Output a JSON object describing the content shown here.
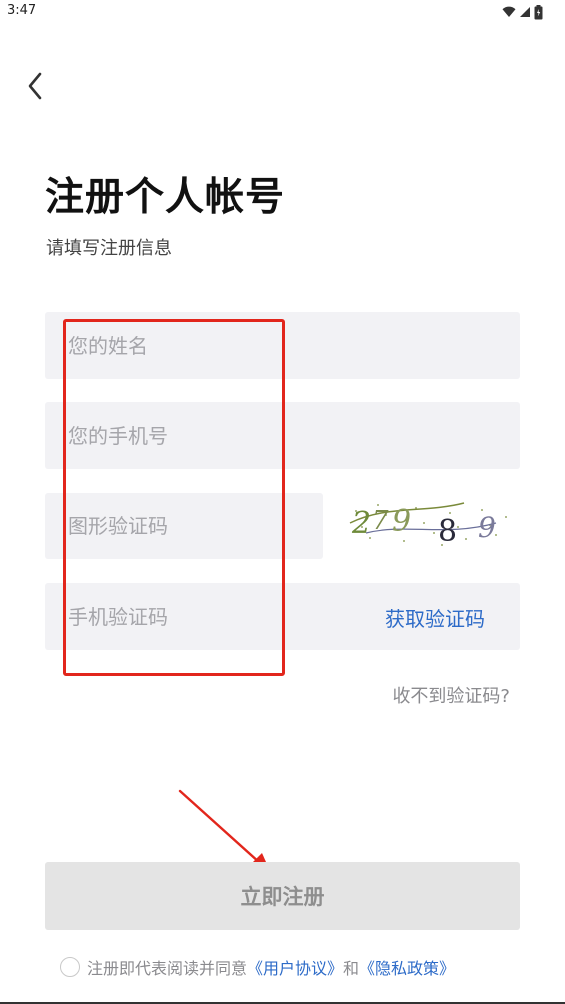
{
  "status_bar": {
    "time": "3:47",
    "icons": [
      "wifi-icon",
      "signal-icon",
      "battery-icon"
    ]
  },
  "header": {
    "back_icon": "chevron-left-icon"
  },
  "title": "注册个人帐号",
  "subtitle": "请填写注册信息",
  "form": {
    "name_placeholder": "您的姓名",
    "phone_placeholder": "您的手机号",
    "captcha_placeholder": "图形验证码",
    "sms_placeholder": "手机验证码",
    "captcha_text": "2 7 9 8 9",
    "get_code_label": "获取验证码",
    "no_code_label": "收不到验证码?"
  },
  "register_button": "立即注册",
  "agreement": {
    "prefix": "注册即代表阅读并同意",
    "user_agreement": "《用户协议》",
    "and": "和",
    "privacy_policy": "《隐私政策》"
  },
  "colors": {
    "link": "#2d6bc8",
    "annotation": "#e2261c",
    "field_bg": "#f2f2f5",
    "button_bg": "#e4e4e4"
  }
}
